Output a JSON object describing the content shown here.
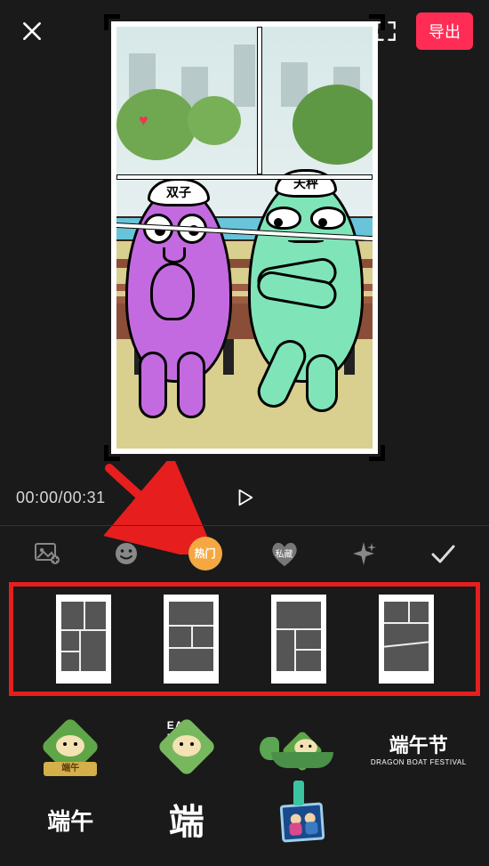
{
  "topbar": {
    "export_label": "导出"
  },
  "preview": {
    "char_left_hat": "双子",
    "char_right_hat": "天秤"
  },
  "time": {
    "current": "00:00",
    "total": "00:31"
  },
  "categories": {
    "hot_label": "热门",
    "fav_label": "私藏"
  },
  "stickers": {
    "row1": [
      {
        "name": "zongzi-banner",
        "banner": "端午"
      },
      {
        "name": "zongzi-eatme",
        "label": "EAT ME"
      },
      {
        "name": "dragon-boat"
      },
      {
        "name": "dragon-boat-festival-title",
        "cn": "端午节",
        "en": "DRAGON BOAT FESTIVAL"
      }
    ],
    "row2": [
      {
        "name": "calligraphy-duanwu-small",
        "text": "端午"
      },
      {
        "name": "calligraphy-duan-large",
        "text": "端"
      },
      {
        "name": "photo-couple"
      }
    ]
  },
  "colors": {
    "accent": "#ff2d55",
    "highlight_box": "#e61e1e",
    "active_tab": "#f5a841"
  }
}
